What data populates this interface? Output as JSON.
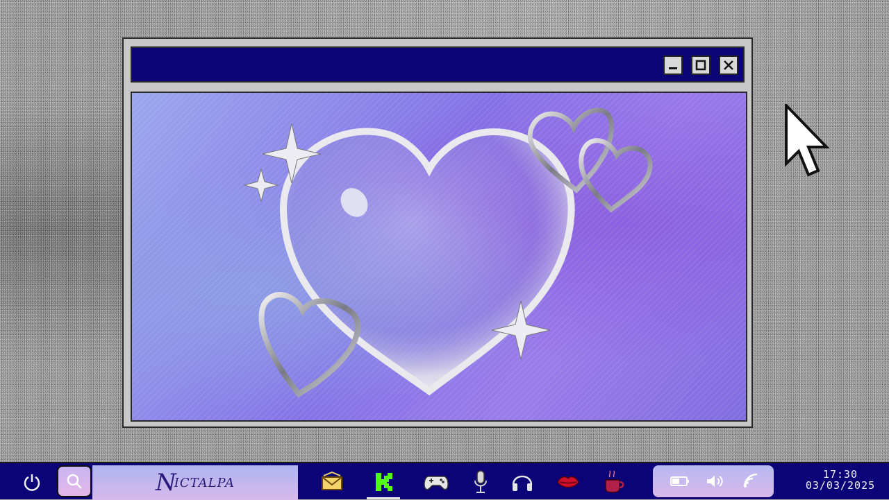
{
  "window": {
    "buttons": {
      "minimize": "minimize",
      "maximize": "maximize",
      "close": "close"
    }
  },
  "taskbar": {
    "brand_text": "ICTALPA",
    "brand_initial": "N",
    "apps": [
      {
        "name": "mail",
        "icon": "envelope-icon"
      },
      {
        "name": "kick",
        "icon": "k-icon",
        "active": true
      },
      {
        "name": "games",
        "icon": "gamepad-icon"
      },
      {
        "name": "microphone",
        "icon": "microphone-icon"
      },
      {
        "name": "headphones",
        "icon": "headphones-icon"
      },
      {
        "name": "lips",
        "icon": "lips-icon"
      },
      {
        "name": "coffee",
        "icon": "coffee-icon"
      }
    ],
    "tray": [
      "battery-icon",
      "volume-icon",
      "wifi-icon"
    ],
    "time": "17:30",
    "date": "03/03/2025"
  },
  "colors": {
    "window_title": "#0b0377",
    "content_purple": "#8472e6",
    "taskbar": "#0b0377",
    "tray_gradient_top": "#b6b9f1",
    "tray_gradient_bottom": "#d9b8ea"
  }
}
